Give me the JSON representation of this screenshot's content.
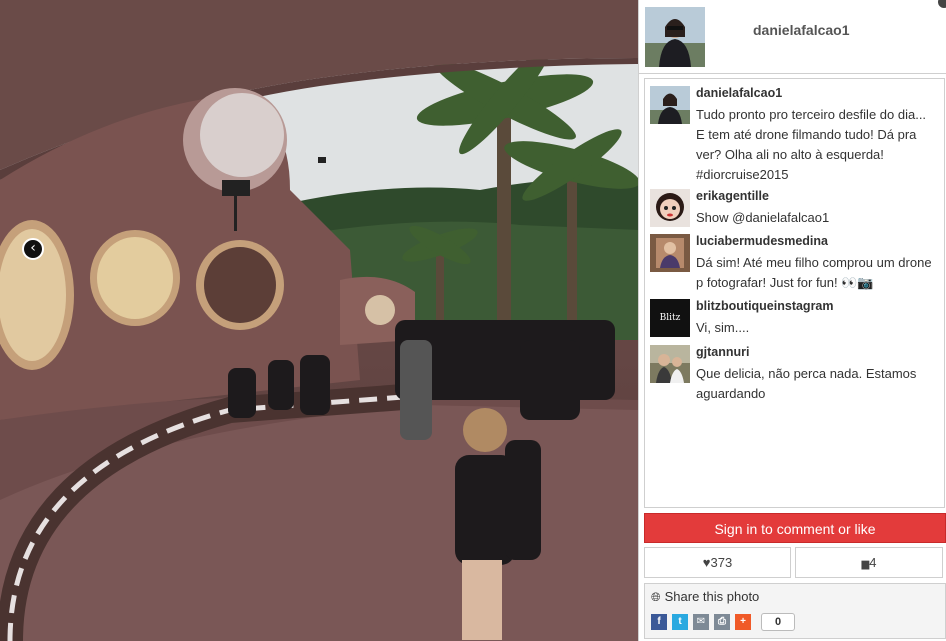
{
  "photo": {
    "prev_arrow": "‹"
  },
  "profile": {
    "username": "danielafalcao1"
  },
  "comments": [
    {
      "user": "danielafalcao1",
      "text": "Tudo pronto pro terceiro desfile do dia... E tem até drone filmando tudo! Dá pra ver? Olha ali no alto à esquerda! #diorcruise2015"
    },
    {
      "user": "erikagentille",
      "text": "Show @danielafalcao1"
    },
    {
      "user": "luciabermudesmedina",
      "text": "Dá sim! Até meu filho comprou um drone p fotografar! Just for fun! 👀📷"
    },
    {
      "user": "blitzboutiqueinstagram",
      "text": "Vi, sim...."
    },
    {
      "user": "gjtannuri",
      "text": "Que delicia, não perca nada. Estamos aguardando"
    }
  ],
  "blitz_avatar_text": "Blitz",
  "actions": {
    "signin_label": "Sign in to comment or like",
    "likes_count": "373",
    "comments_count": "4",
    "heart_glyph": "♥",
    "comment_glyph": "▆"
  },
  "share": {
    "title": "Share this photo",
    "count": "0",
    "icons": [
      "facebook-icon",
      "twitter-icon",
      "email-icon",
      "print-icon",
      "more-icon"
    ]
  },
  "colors": {
    "signin_red": "#e33b3b",
    "facebook": "#3b5998",
    "twitter": "#2aa9e0",
    "email": "#7e8a96",
    "print": "#7e8a96",
    "more": "#f05a28"
  }
}
